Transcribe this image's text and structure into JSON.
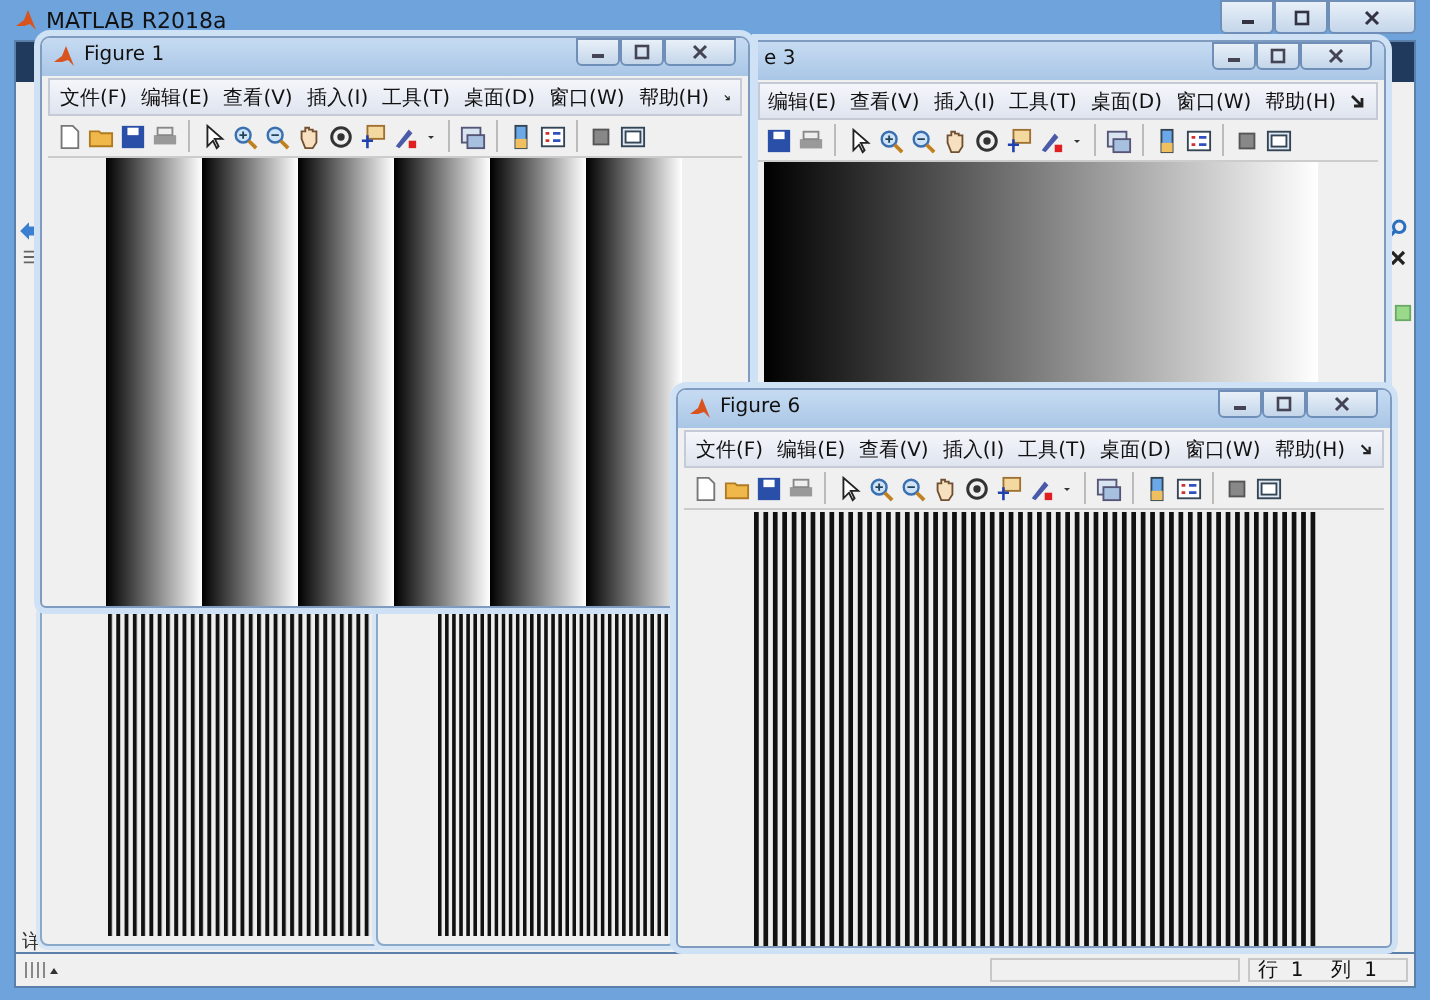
{
  "window": {
    "title": "MATLAB R2018a"
  },
  "left_panel": {
    "label": "详"
  },
  "background_figures": [
    {
      "kind": "fine-stripes"
    },
    {
      "kind": "fine-stripes"
    }
  ],
  "figures": [
    {
      "title": "Figure 1",
      "clipped": false,
      "menu": [
        "文件(F)",
        "编辑(E)",
        "查看(V)",
        "插入(I)",
        "工具(T)",
        "桌面(D)",
        "窗口(W)",
        "帮助(H)"
      ],
      "kind": "gradient-bands"
    },
    {
      "title": "e 3",
      "clipped": true,
      "menu": [
        "编辑(E)",
        "查看(V)",
        "插入(I)",
        "工具(T)",
        "桌面(D)",
        "窗口(W)",
        "帮助(H)"
      ],
      "kind": "gradient"
    },
    {
      "title": "Figure 6",
      "clipped": false,
      "menu": [
        "文件(F)",
        "编辑(E)",
        "查看(V)",
        "插入(I)",
        "工具(T)",
        "桌面(D)",
        "窗口(W)",
        "帮助(H)"
      ],
      "kind": "fine-stripes"
    }
  ],
  "status_bar": {
    "row": "行  1",
    "column": "列  1"
  }
}
